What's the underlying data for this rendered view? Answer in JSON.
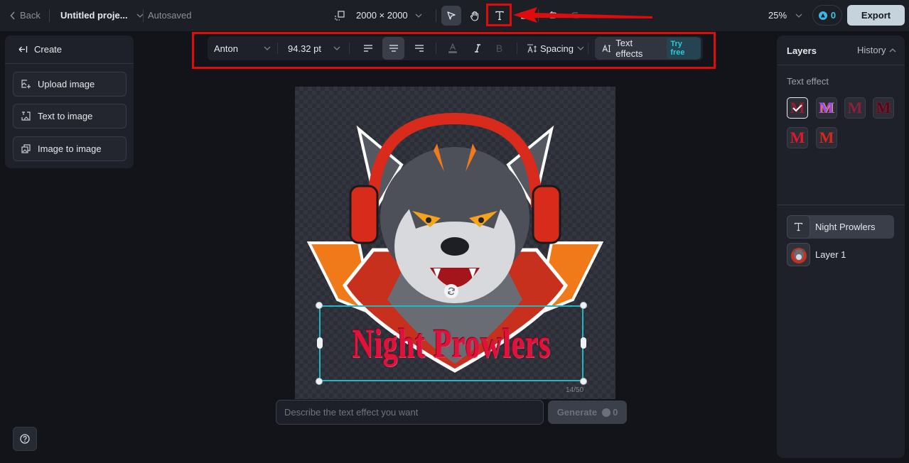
{
  "topbar": {
    "back_label": "Back",
    "project_name": "Untitled proje...",
    "save_status": "Autosaved",
    "canvas_size": "2000 × 2000",
    "zoom": "25%",
    "credits": "0",
    "export_label": "Export"
  },
  "tools": {
    "select": "select-tool",
    "hand": "hand-tool",
    "text": "text-tool",
    "highlighted": "text-tool"
  },
  "left_panel": {
    "header": "Create",
    "buttons": [
      {
        "label": "Upload image",
        "icon": "upload-image-icon"
      },
      {
        "label": "Text to image",
        "icon": "text-to-image-icon"
      },
      {
        "label": "Image to image",
        "icon": "image-to-image-icon"
      }
    ]
  },
  "text_toolbar": {
    "font": "Anton",
    "font_size": "94.32 pt",
    "alignment": "center",
    "spacing_label": "Spacing",
    "text_effects_label": "Text effects",
    "try_free_label": "Try free"
  },
  "canvas": {
    "text_content": "Night Prowlers",
    "char_counter": "14/50"
  },
  "prompt": {
    "placeholder": "Describe the text effect you want",
    "value": "",
    "generate_label": "Generate",
    "generate_cost": "0"
  },
  "right_panel": {
    "layers_tab": "Layers",
    "history_tab": "History",
    "effect_section_label": "Text effect",
    "effects": [
      {
        "glyph": "M",
        "color": "#9b1b30",
        "selected": true
      },
      {
        "glyph": "M",
        "color": "#8a4cff",
        "selected": false
      },
      {
        "glyph": "M",
        "color": "#8e1f3a",
        "selected": false
      },
      {
        "glyph": "M",
        "color": "#4a0d18",
        "selected": false
      },
      {
        "glyph": "M",
        "color": "#e01a2e",
        "selected": false
      },
      {
        "glyph": "M",
        "color": "#d8261d",
        "selected": false
      }
    ],
    "layers": [
      {
        "name": "Night Prowlers",
        "type": "text",
        "active": true
      },
      {
        "name": "Layer 1",
        "type": "image",
        "active": false
      }
    ]
  },
  "colors": {
    "accent_cyan": "#1fb8c4",
    "annotation_red": "#e00b0b",
    "export_bg": "#c6d3dc"
  }
}
